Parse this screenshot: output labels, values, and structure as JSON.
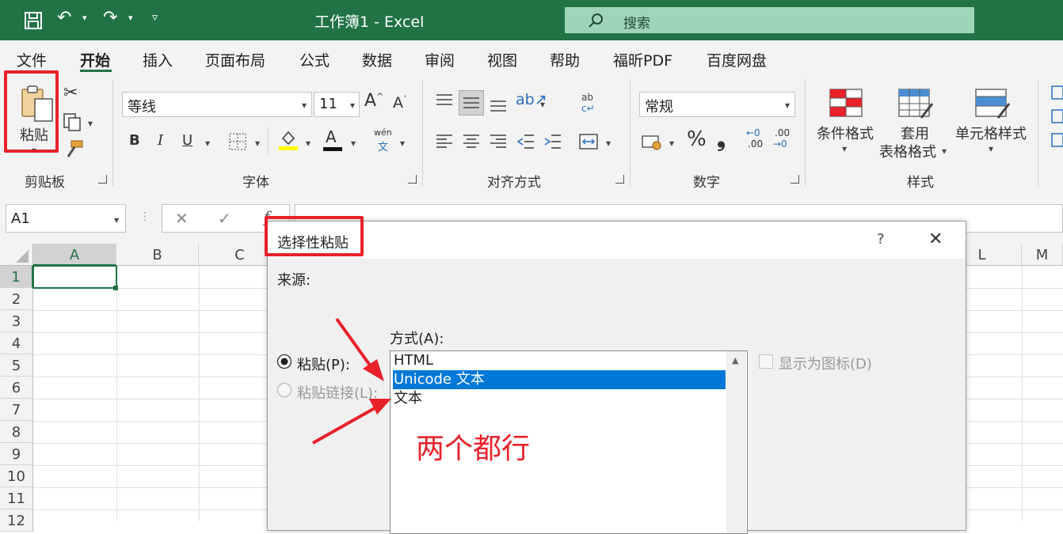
{
  "window": {
    "title": "工作簿1  -  Excel",
    "search_placeholder": "搜索"
  },
  "tabs": [
    "文件",
    "开始",
    "插入",
    "页面布局",
    "公式",
    "数据",
    "审阅",
    "视图",
    "帮助",
    "福昕PDF",
    "百度网盘"
  ],
  "ribbon": {
    "clipboard": {
      "label": "剪贴板",
      "paste": "粘贴"
    },
    "font": {
      "label": "字体",
      "name": "等线",
      "size": "11",
      "grow": "A",
      "shrink": "A",
      "bold": "B",
      "italic": "I",
      "underline": "U",
      "font_color": "A",
      "phonetic_top": "wén",
      "phonetic_bottom": "文"
    },
    "alignment": {
      "label": "对齐方式"
    },
    "number": {
      "label": "数字",
      "format": "常规",
      "percent": "%",
      "comma": "❟",
      "inc_decimal": ".00",
      "dec_decimal": ".00"
    },
    "styles": {
      "label": "样式",
      "conditional": "条件格式",
      "table_line1": "套用",
      "table_line2": "表格格式",
      "cell_styles": "单元格样式"
    }
  },
  "formula_bar": {
    "name_box": "A1",
    "cancel": "✕",
    "enter": "✓",
    "fx": "f"
  },
  "columns": [
    "A",
    "B",
    "C",
    "L",
    "M"
  ],
  "rows": [
    "1",
    "2",
    "3",
    "4",
    "5",
    "6",
    "7",
    "8",
    "9",
    "10",
    "11",
    "12"
  ],
  "dialog": {
    "title": "选择性粘贴",
    "help": "?",
    "close": "✕",
    "source_label": "来源:",
    "as_label": "方式(A):",
    "paste_option": "粘贴(P):",
    "paste_link_option": "粘贴链接(L):",
    "options": [
      "HTML",
      "Unicode 文本",
      "文本"
    ],
    "selected_index": 1,
    "show_as_icon": "显示为图标(D)"
  },
  "annotation": {
    "text": "两个都行",
    "color": "#e8212a"
  },
  "colors": {
    "excel_green": "#217346",
    "selection_blue": "#0078d7"
  }
}
